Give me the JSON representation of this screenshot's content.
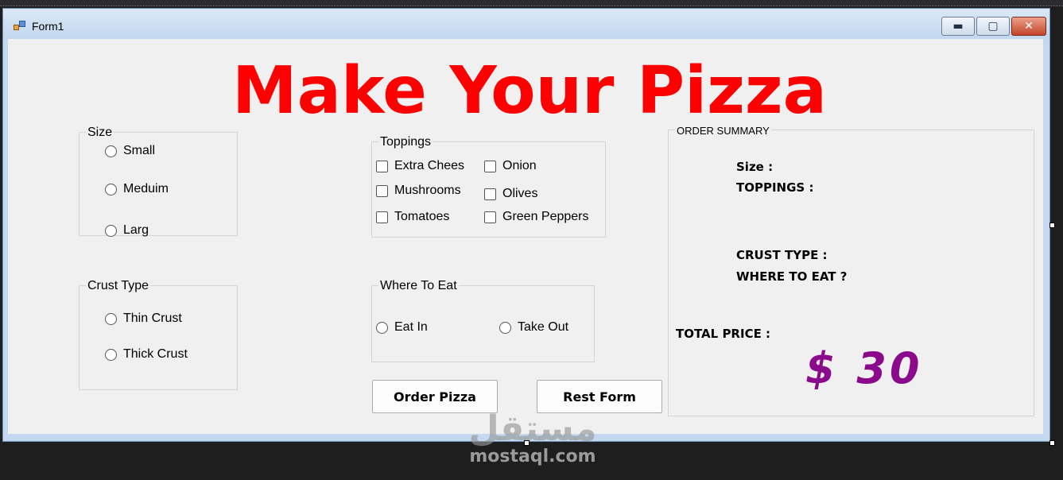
{
  "window": {
    "title": "Form1",
    "controls": {
      "minimize": "▬",
      "maximize": "▢",
      "close": "✕"
    }
  },
  "heading": "Make Your Pizza",
  "size_group": {
    "label": "Size",
    "options": [
      "Small",
      "Meduim",
      "Larg"
    ]
  },
  "crust_group": {
    "label": "Crust Type",
    "options": [
      "Thin Crust",
      "Thick Crust"
    ]
  },
  "toppings_group": {
    "label": "Toppings",
    "options": [
      "Extra Chees",
      "Mushrooms",
      "Tomatoes",
      "Onion",
      "Olives",
      "Green Peppers"
    ]
  },
  "where_group": {
    "label": "Where To Eat",
    "options": [
      "Eat In",
      "Take Out"
    ]
  },
  "buttons": {
    "order": "Order Pizza",
    "reset": "Rest Form"
  },
  "summary": {
    "label": "ORDER SUMMARY",
    "size": "Size :",
    "toppings": "TOPPINGS :",
    "crust": "CRUST TYPE :",
    "where": "WHERE TO EAT ?",
    "total": "TOTAL PRICE :",
    "price": "$ 30"
  },
  "watermark": {
    "arabic": "مستقل",
    "latin": "mostaql.com"
  },
  "colors": {
    "heading": "#ff0000",
    "price": "#8b0a8b"
  }
}
